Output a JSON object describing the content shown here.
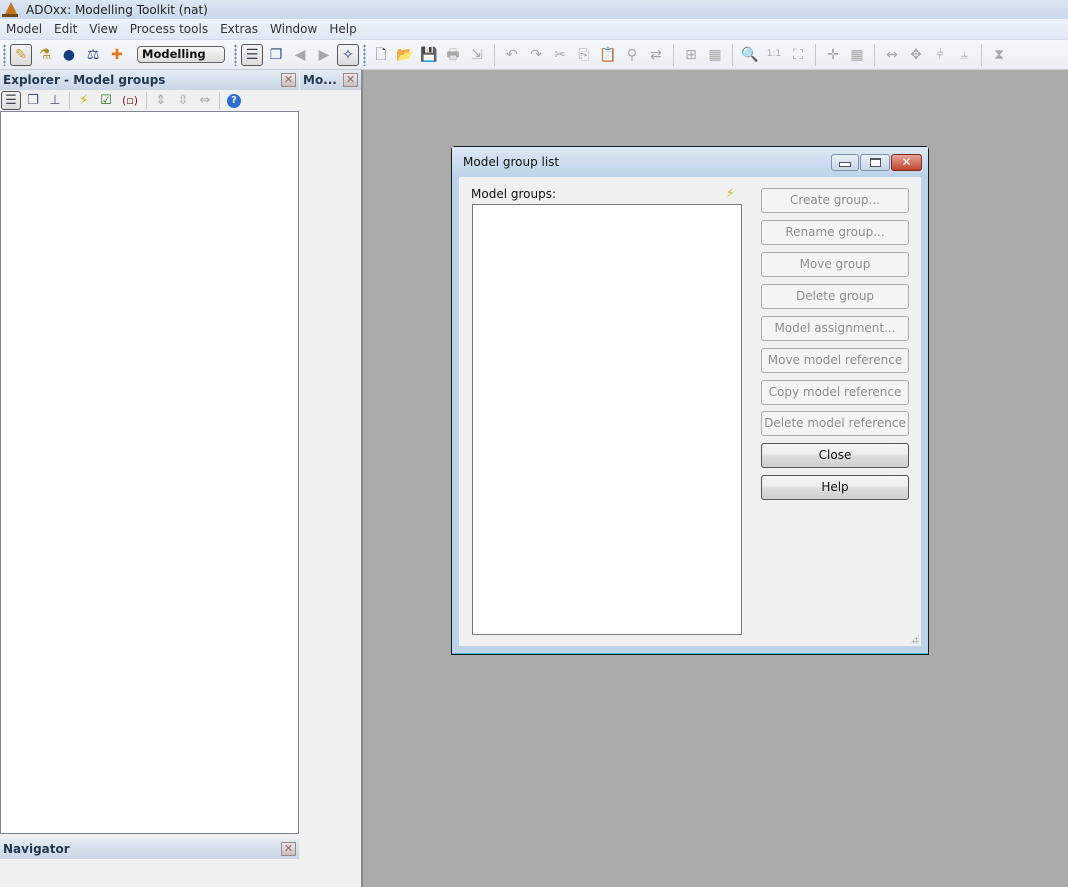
{
  "window": {
    "title": "ADOxx: Modelling Toolkit (nat)",
    "app_icon": "adoxx-logo-icon"
  },
  "menubar": {
    "items": [
      "Model",
      "Edit",
      "View",
      "Process tools",
      "Extras",
      "Window",
      "Help"
    ]
  },
  "toolbar": {
    "mode_select_value": "Modelling",
    "icons": {
      "modelling": "✎",
      "analysis": "⚗",
      "simulation": "●",
      "evaluation": "⚖",
      "import_export": "✚",
      "model_groups": "☰",
      "windows": "❐",
      "back": "◀",
      "forward": "▶",
      "navigator": "✧",
      "new": "🗋",
      "open": "📂",
      "save": "💾",
      "print": "🖶",
      "export": "⇲",
      "undo": "↶",
      "redo": "↷",
      "cut": "✂",
      "copy": "⎘",
      "paste": "📋",
      "find": "⚲",
      "replace": "⇄",
      "insert_table": "⊞",
      "table": "▦",
      "zoom": "🔍",
      "zoom_100": "1:1",
      "zoom_fit": "⛶",
      "crosshair": "✛",
      "grid": "▦",
      "align_h": "↔",
      "align_move": "✥",
      "align_center_v": "⫩",
      "align_center_h": "⫨",
      "hourglass": "⧗"
    }
  },
  "explorer": {
    "title": "Explorer - Model groups",
    "close": "✕",
    "icons": {
      "model_groups": "☰",
      "windows": "❐",
      "tree": "⊥",
      "refresh": "⚡",
      "check_folder": "☑",
      "paren_doc": "(▫)",
      "expand": "⇕",
      "collapse": "⇳",
      "expand_all": "⇔",
      "help": "?"
    }
  },
  "mo_panel": {
    "title": "Mo...",
    "close": "✕"
  },
  "navigator": {
    "title": "Navigator",
    "close": "✕"
  },
  "dialog": {
    "title": "Model group list",
    "label_groups": "Model groups:",
    "refresh_icon": "⚡",
    "close_glyph": "✕",
    "groups": [],
    "buttons": {
      "create_group": "Create group...",
      "rename_group": "Rename group...",
      "move_group": "Move group",
      "delete_group": "Delete group",
      "model_assignment": "Model assignment...",
      "move_model_reference": "Move model reference",
      "copy_model_reference": "Copy model reference",
      "delete_model_reference": "Delete model reference",
      "close": "Close",
      "help": "Help"
    }
  },
  "colors": {
    "workspace": "#ababab",
    "panel_header": "#c8d6e7",
    "dialog_frame": "#bcd3ea",
    "close_button": "#c0442f",
    "disabled_text": "#8d8d8d"
  }
}
